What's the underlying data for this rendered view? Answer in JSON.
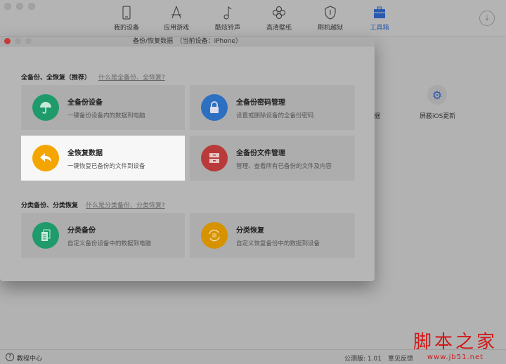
{
  "toolbar": {
    "nav": [
      {
        "label": "我的设备",
        "icon": "phone-icon"
      },
      {
        "label": "应用游戏",
        "icon": "app-store-icon"
      },
      {
        "label": "酷炫铃声",
        "icon": "music-note-icon"
      },
      {
        "label": "高清壁纸",
        "icon": "clover-icon"
      },
      {
        "label": "刷机越狱",
        "icon": "shield-key-icon"
      },
      {
        "label": "工具箱",
        "icon": "toolbox-icon"
      }
    ],
    "active": "工具箱"
  },
  "background": {
    "partial_text": "据",
    "ios_update": "屏蔽iOS更新"
  },
  "modal": {
    "title": "备份/恢复数据　（当前设备：iPhone）",
    "section1": {
      "title": "全备份、全恢复（推荐）",
      "help": "什么是全备份、全恢复?"
    },
    "section2": {
      "title": "分类备份、分类恢复",
      "help": "什么是分类备份、分类恢复?"
    },
    "cards": [
      {
        "title": "全备份设备",
        "desc": "一键备份设备内的数据到电脑",
        "color": "#1f9a6a"
      },
      {
        "title": "全备份密码管理",
        "desc": "设置或删除设备的全备份密码",
        "color": "#2d6fc0"
      },
      {
        "title": "全恢复数据",
        "desc": "一键恢复已备份的文件到设备",
        "color": "#f5a500"
      },
      {
        "title": "全备份文件管理",
        "desc": "管理、查看所有已备份的文件及内容",
        "color": "#b83a3a"
      },
      {
        "title": "分类备份",
        "desc": "自定义备份设备中的数据到电脑",
        "color": "#1f9a6a"
      },
      {
        "title": "分类恢复",
        "desc": "自定义恢复备份中的数据到设备",
        "color": "#d79200"
      }
    ]
  },
  "status": {
    "tutorial": "教程中心",
    "version": "公测版: 1.01",
    "feedback": "意见反馈"
  },
  "watermark": {
    "name": "脚本之家",
    "url": "www.jb51.net"
  }
}
